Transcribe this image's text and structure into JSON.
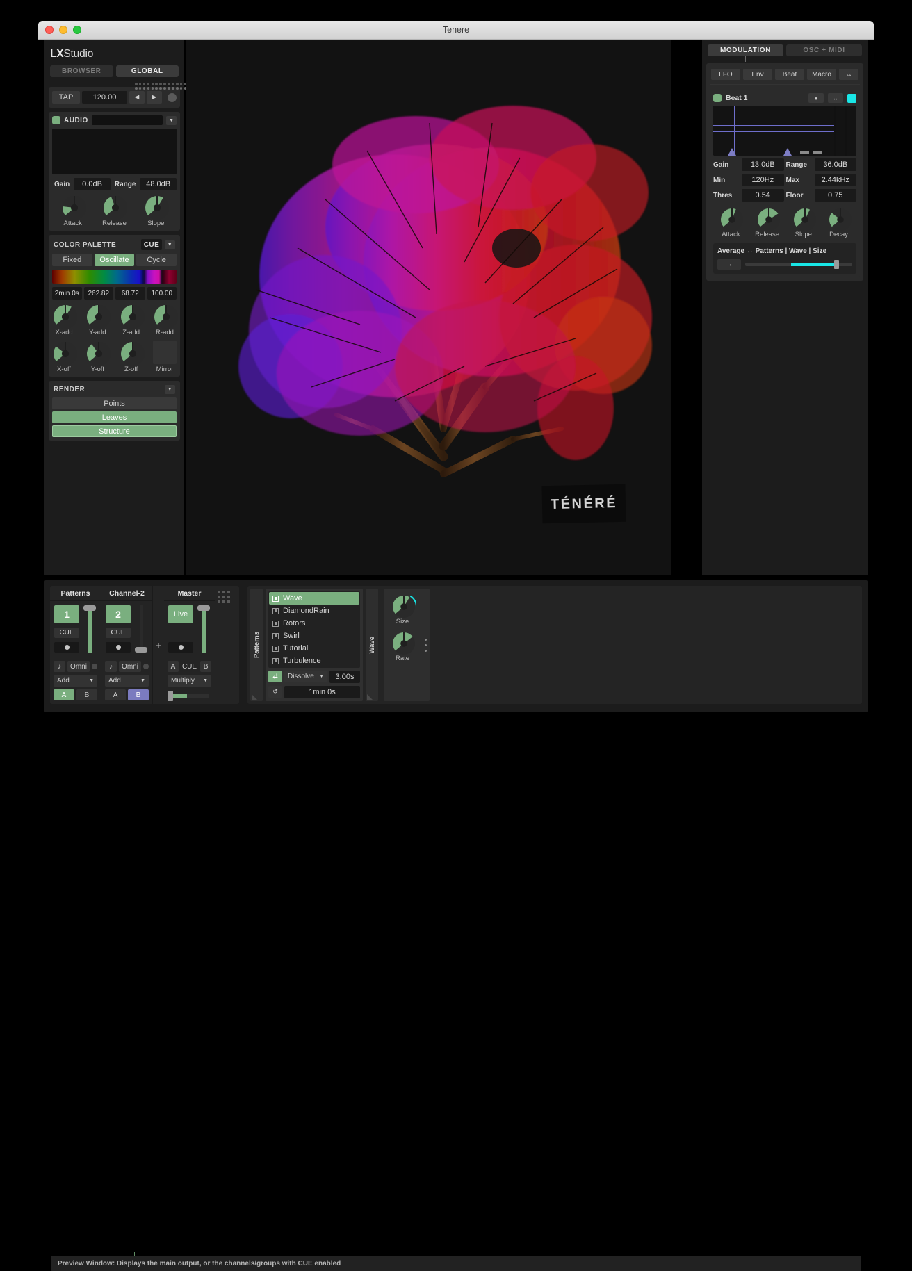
{
  "window": {
    "title": "Tenere"
  },
  "app": {
    "logo_bold": "LX",
    "logo_light": "Studio"
  },
  "main_tabs": [
    {
      "label": "BROWSER",
      "active": false
    },
    {
      "label": "GLOBAL",
      "active": true
    }
  ],
  "tempo": {
    "tap_label": "TAP",
    "bpm": "120.00",
    "prev": "◄",
    "next": "►"
  },
  "audio": {
    "title": "AUDIO",
    "gain_label": "Gain",
    "gain_value": "0.0dB",
    "range_label": "Range",
    "range_value": "48.0dB",
    "knobs": [
      {
        "label": "Attack",
        "value": 0.18
      },
      {
        "label": "Release",
        "value": 0.42
      },
      {
        "label": "Slope",
        "value": 0.62
      }
    ]
  },
  "color_palette": {
    "title": "COLOR PALETTE",
    "cue_label": "CUE",
    "modes": [
      {
        "label": "Fixed",
        "active": false
      },
      {
        "label": "Oscillate",
        "active": true
      },
      {
        "label": "Cycle",
        "active": false
      }
    ],
    "numbers": [
      "2min 0s",
      "262.82",
      "68.72",
      "100.00"
    ],
    "knobs_row1": [
      {
        "label": "X-add",
        "value": 0.62
      },
      {
        "label": "Y-add",
        "value": 0.5
      },
      {
        "label": "Z-add",
        "value": 0.51
      },
      {
        "label": "R-add",
        "value": 0.5
      }
    ],
    "knobs_row2": [
      {
        "label": "X-off",
        "value": 0.3
      },
      {
        "label": "Y-off",
        "value": 0.36
      },
      {
        "label": "Z-off",
        "value": 0.5
      }
    ],
    "mirror_label": "Mirror"
  },
  "render": {
    "title": "RENDER",
    "items": [
      {
        "label": "Points",
        "active": false,
        "outlined": false
      },
      {
        "label": "Leaves",
        "active": true,
        "outlined": false
      },
      {
        "label": "Structure",
        "active": true,
        "outlined": true
      }
    ]
  },
  "preview": {
    "sign_text": "TÉNÉRÉ"
  },
  "right_tabs": [
    {
      "label": "MODULATION",
      "active": true
    },
    {
      "label": "OSC + MIDI",
      "active": false
    }
  ],
  "modulation": {
    "sub_tabs": [
      {
        "label": "LFO"
      },
      {
        "label": "Env"
      },
      {
        "label": "Beat"
      },
      {
        "label": "Macro"
      },
      {
        "label": "↔"
      }
    ],
    "card": {
      "name": "Beat 1",
      "mini_buttons": [
        "●",
        "↔"
      ],
      "fields": [
        {
          "key": "Gain",
          "value": "13.0dB",
          "key2": "Range",
          "value2": "36.0dB"
        },
        {
          "key": "Min",
          "value": "120Hz",
          "key2": "Max",
          "value2": "2.44kHz"
        },
        {
          "key": "Thres",
          "value": "0.54",
          "key2": "Floor",
          "value2": "0.75"
        }
      ],
      "knobs": [
        {
          "label": "Attack",
          "value": 0.58
        },
        {
          "label": "Release",
          "value": 0.72
        },
        {
          "label": "Slope",
          "value": 0.6
        },
        {
          "label": "Decay",
          "value": 0.3
        }
      ]
    },
    "mapping": {
      "title": "Average ↔ Patterns | Wave | Size",
      "arrow": "→"
    }
  },
  "mixer": {
    "channels": [
      {
        "title": "Patterns",
        "number": "1",
        "cue": "CUE",
        "fader_level": 1.0,
        "midi_note": "♪",
        "midi_channel": "Omni",
        "blend": "Add",
        "ab": [
          {
            "label": "A",
            "state": "green"
          },
          {
            "label": "B",
            "state": "off"
          }
        ]
      },
      {
        "title": "Channel-2",
        "number": "2",
        "cue": "CUE",
        "fader_level": 0.04,
        "midi_note": "♪",
        "midi_channel": "Omni",
        "blend": "Add",
        "ab": [
          {
            "label": "A",
            "state": "off"
          },
          {
            "label": "B",
            "state": "blue"
          }
        ]
      }
    ],
    "plus": "+",
    "master": {
      "title": "Master",
      "live_label": "Live",
      "fader_level": 1.0,
      "a_label": "A",
      "cue_label": "CUE",
      "b_label": "B",
      "blend": "Multiply"
    }
  },
  "device_area": {
    "patterns_tab": "Patterns",
    "wave_tab": "Wave",
    "pattern_list": [
      {
        "label": "Wave",
        "selected": true
      },
      {
        "label": "DiamondRain",
        "selected": false
      },
      {
        "label": "Rotors",
        "selected": false
      },
      {
        "label": "Swirl",
        "selected": false
      },
      {
        "label": "Tutorial",
        "selected": false
      },
      {
        "label": "Turbulence",
        "selected": false
      }
    ],
    "transition": {
      "mode": "Dissolve",
      "time": "3.00s",
      "auto_cycle": "1min 0s",
      "shuffle_icon": "⇄",
      "loop_icon": "↺"
    },
    "wave_knobs": [
      {
        "label": "Size",
        "value": 0.62,
        "modulated": true
      },
      {
        "label": "Rate",
        "value": 0.7,
        "modulated": false
      }
    ]
  },
  "statusbar": {
    "text": "Preview Window: Displays the main output, or the channels/groups with CUE enabled"
  },
  "colors": {
    "accent_green": "#7aaf7f",
    "accent_cyan": "#19e6e6",
    "accent_blue": "#7b7bbf",
    "panel_bg": "#1c1c1c",
    "section_bg": "#2b2b2b"
  }
}
